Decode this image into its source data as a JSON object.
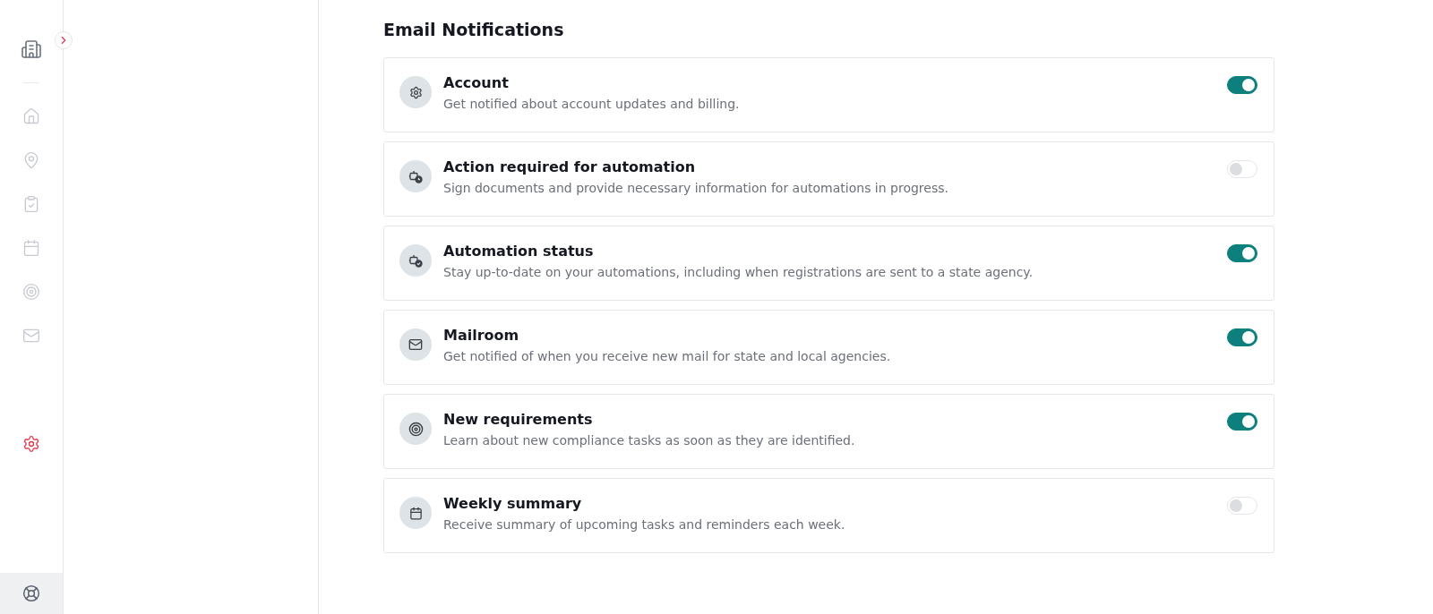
{
  "sidebar": {
    "items": [
      {
        "selected": false
      },
      {
        "selected": false
      },
      {
        "selected": false
      },
      {
        "selected": false
      },
      {
        "selected": false
      },
      {
        "selected": false
      },
      {
        "selected": true
      }
    ]
  },
  "section_title": "Email Notifications",
  "notifications": [
    {
      "title": "Account",
      "description": "Get notified about account updates and billing.",
      "on": true
    },
    {
      "title": "Action required for automation",
      "description": "Sign documents and provide necessary information for automations in progress.",
      "on": false
    },
    {
      "title": "Automation status",
      "description": "Stay up-to-date on your automations, including when registrations are sent to a state agency.",
      "on": true
    },
    {
      "title": "Mailroom",
      "description": "Get notified of when you receive new mail for state and local agencies.",
      "on": true
    },
    {
      "title": "New requirements",
      "description": "Learn about new compliance tasks as soon as they are identified.",
      "on": true
    },
    {
      "title": "Weekly summary",
      "description": "Receive summary of upcoming tasks and reminders each week.",
      "on": false
    }
  ]
}
